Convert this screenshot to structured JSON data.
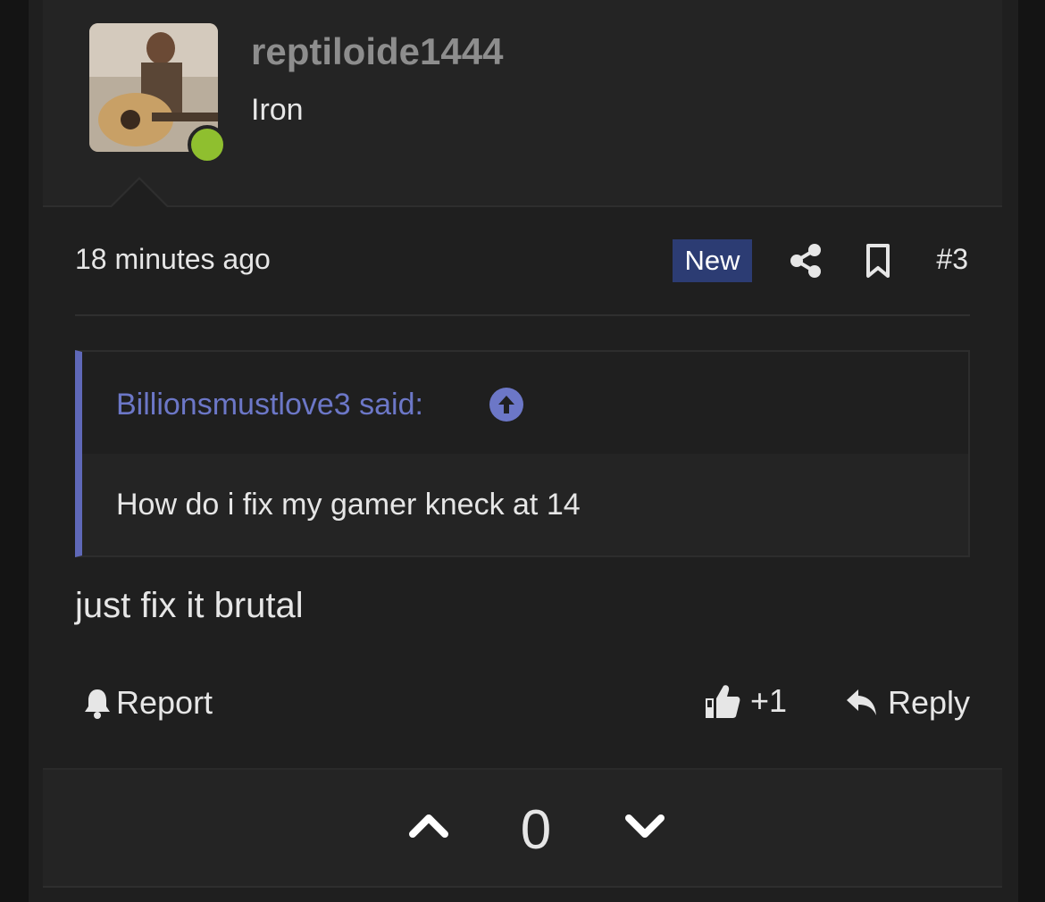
{
  "user": {
    "username": "reptiloide1444",
    "user_title": "Iron",
    "online": true,
    "online_color": "#8fbf2f"
  },
  "post": {
    "time": "18 minutes ago",
    "badge": "New",
    "badge_color": "#2c3c73",
    "post_number": "#3",
    "icons": [
      "share-icon",
      "bookmark-icon"
    ]
  },
  "quote": {
    "author": "Billionsmustlove3 said:",
    "text": "How do i fix my gamer kneck at 14",
    "accent_color": "#5f68b8",
    "icon": "arrow-up-circle-icon"
  },
  "message": "just fix it brutal",
  "actions": {
    "report_label": "Report",
    "like_label": "+1",
    "reply_label": "Reply",
    "icons": [
      "bell-icon",
      "thumbs-up-icon",
      "reply-icon"
    ]
  },
  "votes": {
    "score": "0",
    "icons": [
      "chevron-up-icon",
      "chevron-down-icon"
    ]
  }
}
